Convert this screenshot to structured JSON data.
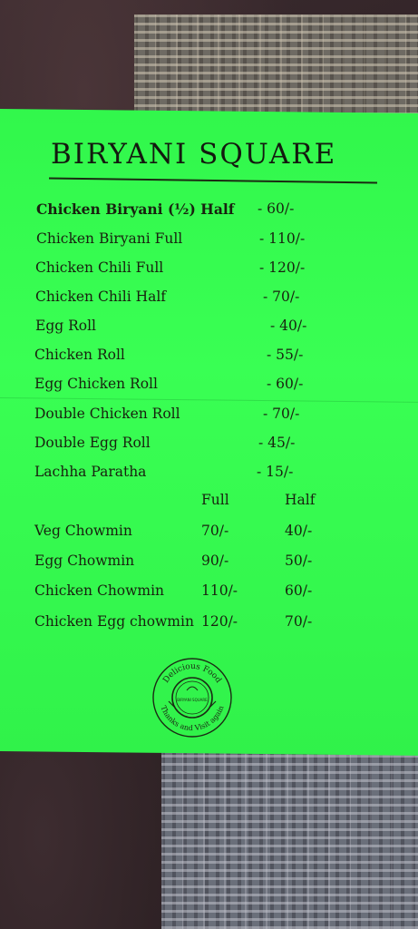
{
  "menu": {
    "title": "BIRYANI SQUARE",
    "items": [
      {
        "name": "Chicken Biryani (½) Half",
        "price": "- 60/-"
      },
      {
        "name": "Chicken Biryani Full",
        "price": "- 110/-"
      },
      {
        "name": "Chicken Chili Full",
        "price": "- 120/-"
      },
      {
        "name": "Chicken Chili Half",
        "price": "- 70/-"
      },
      {
        "name": "Egg Roll",
        "price": "- 40/-"
      },
      {
        "name": "Chicken Roll",
        "price": "- 55/-"
      },
      {
        "name": "Egg Chicken Roll",
        "price": "- 60/-"
      },
      {
        "name": "Double Chicken Roll",
        "price": "- 70/-"
      },
      {
        "name": "Double Egg Roll",
        "price": "- 45/-"
      },
      {
        "name": "Lachha Paratha",
        "price": "- 15/-"
      }
    ],
    "chowmin_header": {
      "full": "Full",
      "half": "Half"
    },
    "chowmin": [
      {
        "name": "Veg Chowmin",
        "full": "70/-",
        "half": "40/-"
      },
      {
        "name": "Egg Chowmin",
        "full": "90/-",
        "half": "50/-"
      },
      {
        "name": "Chicken Chowmin",
        "full": "110/-",
        "half": "60/-"
      },
      {
        "name": "Chicken Egg chowmin",
        "full": "120/-",
        "half": "70/-"
      }
    ]
  },
  "seal": {
    "top_text": "Delicious Food",
    "bottom_text": "Thanks and Visit again",
    "center_text": "BIRYANI SQUARE"
  },
  "colors": {
    "paper": "#33ff4e",
    "ink": "#18210f"
  }
}
